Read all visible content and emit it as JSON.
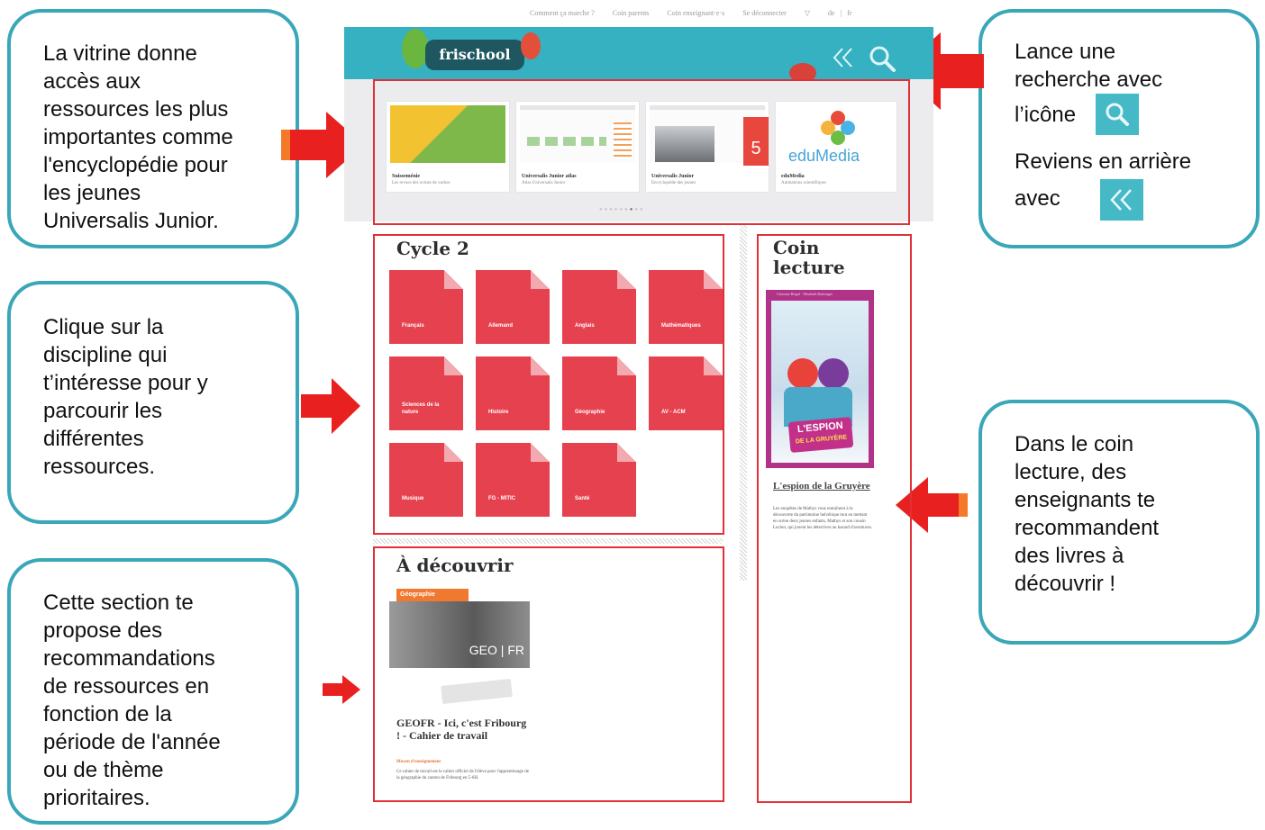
{
  "callouts": {
    "vitrine": "La vitrine donne\naccès aux\nressources les plus\nimportantes comme\nl'encyclopédie pour\nles jeunes\nUniversalis Junior.",
    "discipline": "Clique sur la\ndiscipline qui\nt’intéresse pour y\nparcourir les\ndifférentes\nressources.",
    "section": "Cette section te\npropose des\nrecommandations\nde ressources en\nfonction de la\npériode de l'année\nou de thème\nprioritaires.",
    "search_line1": "Lance une\nrecherche avec",
    "search_line2": "l’icône",
    "back_line1": "Reviens en arrière",
    "back_line2": "avec",
    "lecture": "Dans le coin\nlecture, des\nenseignants te\nrecommandent\ndes livres à\ndécouvrir !"
  },
  "site": {
    "topnav": [
      "Comment ça marche ?",
      "Coin parents",
      "Coin enseignant·e·s",
      "Se déconnecter",
      "▽",
      "de",
      "|",
      "fr"
    ],
    "logo": "frischool",
    "vitrine": [
      {
        "title": "Suisseménie",
        "sub": "Les revues des ovines de vaches"
      },
      {
        "title": "Universalis Junior atlas",
        "sub": "Atlas Universalis Junior"
      },
      {
        "title": "Universalis Junior",
        "sub": "Encyclopédie des jeunes"
      },
      {
        "title": "eduMedia",
        "sub": "Animations scientifiques",
        "brand": "eduMedia"
      }
    ],
    "cycle_title": "Cycle 2",
    "disciplines": [
      "Français",
      "Allemand",
      "Anglais",
      "Mathématiques",
      "Sciences de la nature",
      "Histoire",
      "Géographie",
      "AV - ACM",
      "Musique",
      "FG - MITIC",
      "Santé"
    ],
    "decouvrir_title": "À découvrir",
    "decouvrir_tag": "Géographie",
    "decouvrir_img_text": "GEO | FR",
    "decouvrir_item_title": "GEOFR - Ici, c'est Fribourg ! - Cahier de travail",
    "decouvrir_item_meta": "Moyen d'enseignement",
    "decouvrir_item_desc": "Ce cahier de travail est le cahier officiel de l'élève pour l'apprentissage de la géographie du canton de Fribourg en 5-6H.",
    "coin_title_1": "Coin",
    "coin_title_2": "lecture",
    "book_authors": "Christine Beigel · Elisabeth Baltzinger",
    "book_cover_title_1": "L'ESPION",
    "book_cover_title_2": "DE LA GRUYÈRE",
    "book_title": "L'espion de la Gruyère",
    "book_desc": "Les enquêtes de Mathys vous entraînent à la découverte du patrimoine helvétique tout en mettant en scène deux jeunes enfants, Mathys et son cousin Lucien, qui jouent les détectives au hasard d'aventures."
  },
  "colors": {
    "teal": "#3aa7b9",
    "banner": "#35b1c2",
    "tile": "#e6414f",
    "frame": "#e03139",
    "arrow": "#e8201f"
  }
}
